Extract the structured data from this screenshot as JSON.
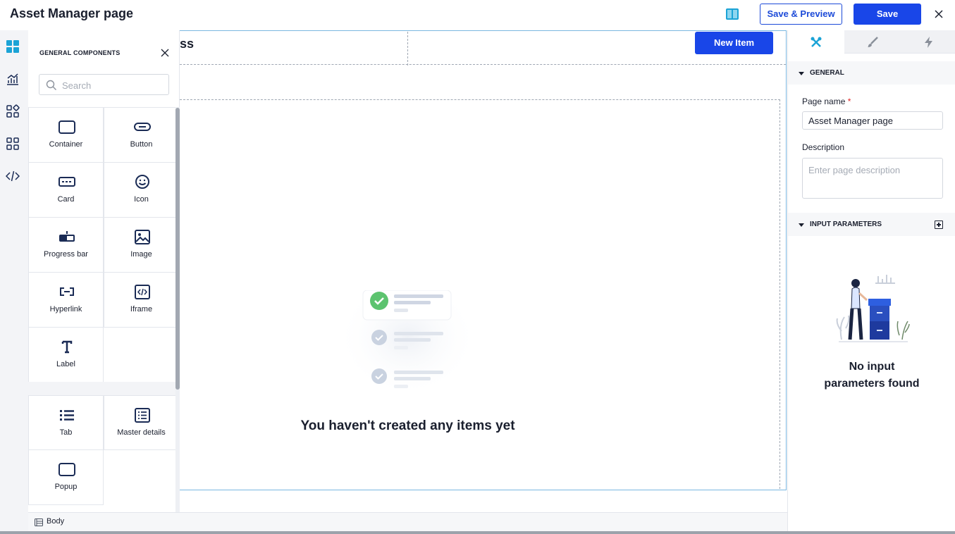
{
  "app": {
    "title": "Asset Manager page",
    "save_preview_label": "Save & Preview",
    "save_label": "Save"
  },
  "left_rail": {
    "icons": [
      "dashboard-icon",
      "analytics-icon",
      "components-icon",
      "apps-grid-icon",
      "code-icon"
    ]
  },
  "palette": {
    "title": "GENERAL COMPONENTS",
    "search_placeholder": "Search",
    "components": [
      {
        "label": "Container",
        "icon": "container-icon"
      },
      {
        "label": "Button",
        "icon": "button-icon"
      },
      {
        "label": "Card",
        "icon": "card-icon"
      },
      {
        "label": "Icon",
        "icon": "smiley-icon"
      },
      {
        "label": "Progress bar",
        "icon": "progress-bar-icon"
      },
      {
        "label": "Image",
        "icon": "image-icon"
      },
      {
        "label": "Hyperlink",
        "icon": "hyperlink-icon"
      },
      {
        "label": "Iframe",
        "icon": "iframe-icon"
      },
      {
        "label": "Label",
        "icon": "label-icon"
      },
      {
        "label": "Tab",
        "icon": "tab-icon"
      },
      {
        "label": "Master details",
        "icon": "master-details-icon"
      },
      {
        "label": "Popup",
        "icon": "popup-icon"
      }
    ]
  },
  "canvas": {
    "heading": "ss",
    "new_item_label": "New Item",
    "empty_text": "You haven't created any items yet"
  },
  "footer": {
    "breadcrumb": "Body"
  },
  "properties": {
    "tabs": [
      "properties-tools-icon",
      "styles-brush-icon",
      "events-bolt-icon"
    ],
    "general_label": "GENERAL",
    "page_name_label": "Page name",
    "page_name_value": "Asset Manager page",
    "description_label": "Description",
    "description_placeholder": "Enter page description",
    "input_params_label": "INPUT PARAMETERS",
    "no_params_text": "No input parameters found"
  },
  "colors": {
    "primary": "#1946e8",
    "accent": "#1ba3d6",
    "success": "#5cc36f"
  }
}
